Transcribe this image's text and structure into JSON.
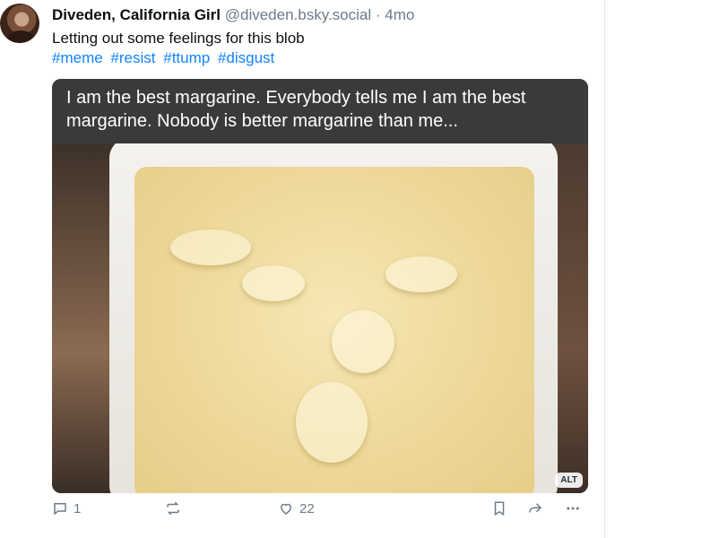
{
  "post": {
    "author_name": "Diveden, California Girl",
    "handle": "@diveden.bsky.social",
    "separator": "·",
    "time": "4mo",
    "text": "Letting out some feelings for this blob",
    "hashtags": [
      "#meme",
      "#resist",
      "#ttump",
      "#disgust"
    ]
  },
  "media": {
    "caption": "I am the best margarine. Everybody tells me I am the best margarine. Nobody is better margarine than me...",
    "alt_badge": "ALT"
  },
  "actions": {
    "reply_count": "1",
    "like_count": "22",
    "icons": [
      "reply-icon",
      "repost-icon",
      "like-icon",
      "bookmark-icon",
      "share-icon",
      "more-icon"
    ]
  },
  "colors": {
    "hashtag": "#1083fe",
    "muted": "#6f7b89"
  }
}
